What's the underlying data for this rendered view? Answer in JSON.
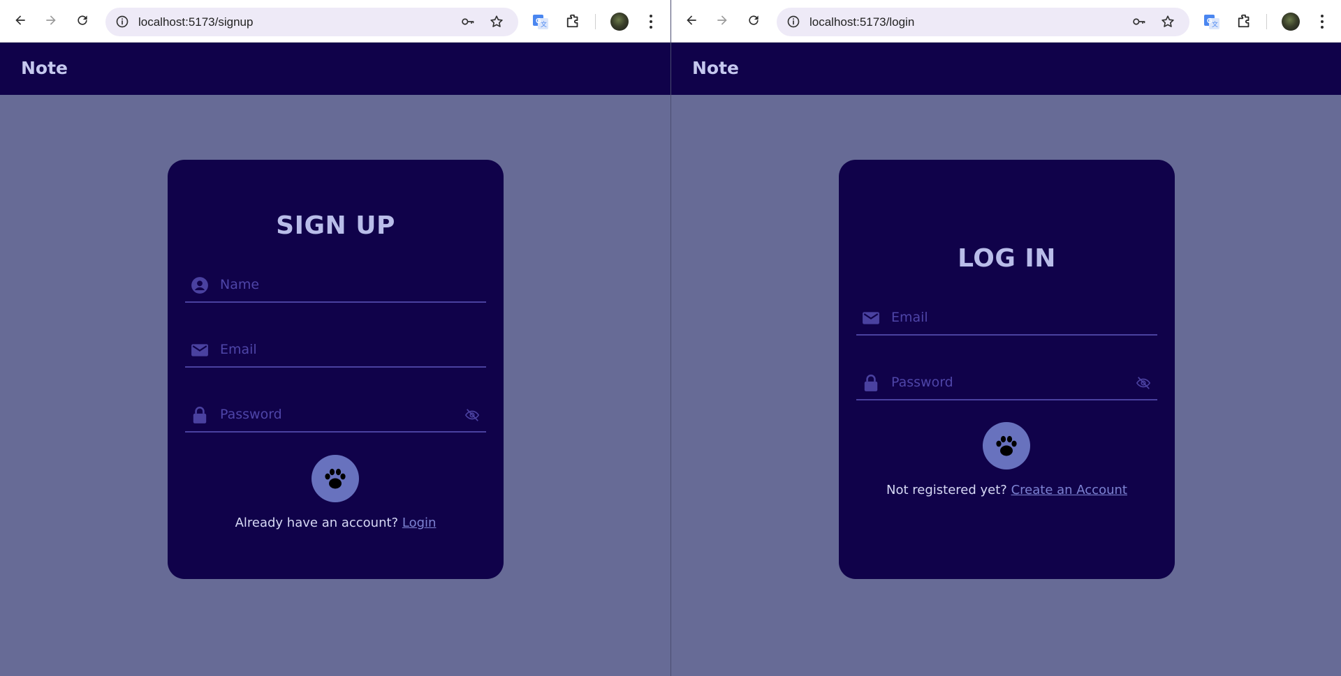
{
  "left": {
    "url": "localhost:5173/signup",
    "app_title": "Note",
    "form": {
      "title": "SIGN UP",
      "name_placeholder": "Name",
      "email_placeholder": "Email",
      "password_placeholder": "Password",
      "footer_text": "Already have an account?",
      "footer_link": "Login"
    }
  },
  "right": {
    "url": "localhost:5173/login",
    "app_title": "Note",
    "form": {
      "title": "LOG IN",
      "email_placeholder": "Email",
      "password_placeholder": "Password",
      "footer_text": "Not registered yet?",
      "footer_link": "Create an Account"
    }
  },
  "colors": {
    "page_background": "#676b96",
    "header_background": "#10024a",
    "card_background": "#10024a",
    "title_text": "#b9bde9",
    "field_accent": "#4a41a0",
    "paw_button": "#6872be",
    "link": "#7d83d2"
  },
  "icons": {
    "toolbar": [
      "back-arrow-icon",
      "forward-arrow-icon",
      "reload-icon",
      "info-icon",
      "key-icon",
      "star-icon",
      "google-translate-icon",
      "extensions-puzzle-icon",
      "profile-avatar",
      "more-vert-icon"
    ],
    "form": [
      "person-icon",
      "email-icon",
      "lock-icon",
      "eye-off-icon",
      "paw-icon"
    ]
  }
}
